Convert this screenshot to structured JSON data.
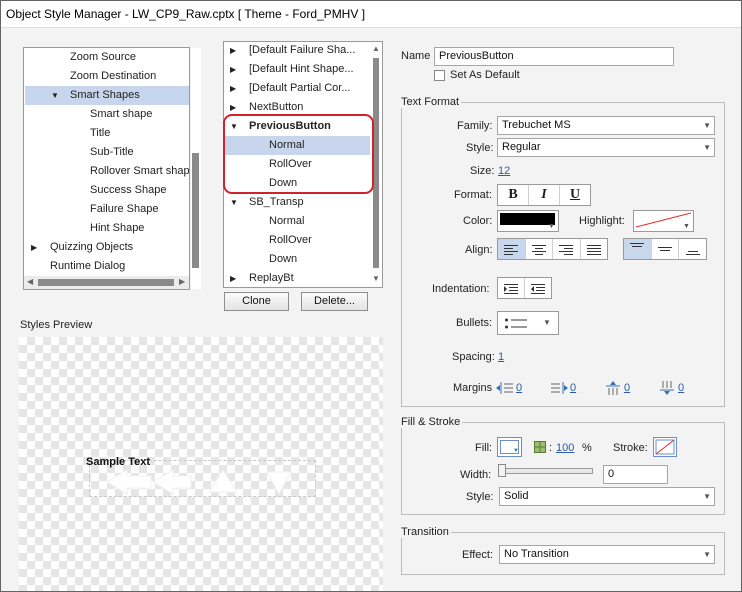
{
  "window": {
    "title": "Object Style Manager - LW_CP9_Raw.cptx [ Theme - Ford_PMHV ]"
  },
  "left_tree": {
    "items": [
      {
        "label": "Zoom Source",
        "level": 1,
        "selected": false
      },
      {
        "label": "Zoom Destination",
        "level": 1,
        "selected": false
      },
      {
        "label": "Smart Shapes",
        "level": 1,
        "expanded": true,
        "selected": true
      },
      {
        "label": "Smart shape",
        "level": 2,
        "selected": false
      },
      {
        "label": "Title",
        "level": 2,
        "selected": false
      },
      {
        "label": "Sub-Title",
        "level": 2,
        "selected": false
      },
      {
        "label": "Rollover Smart shap",
        "level": 2,
        "selected": false
      },
      {
        "label": "Success Shape",
        "level": 2,
        "selected": false
      },
      {
        "label": "Failure Shape",
        "level": 2,
        "selected": false
      },
      {
        "label": "Hint Shape",
        "level": 2,
        "selected": false
      },
      {
        "label": "Quizzing Objects",
        "level": 0,
        "collapsed": true,
        "selected": false
      },
      {
        "label": "Runtime Dialog",
        "level": 0,
        "selected": false
      }
    ]
  },
  "mid_tree": {
    "items": [
      {
        "label": "[Default Failure Sha...",
        "collapsed": true
      },
      {
        "label": "[Default Hint Shape...",
        "collapsed": true
      },
      {
        "label": "[Default Partial Cor...",
        "collapsed": true
      },
      {
        "label": "NextButton",
        "collapsed": true
      },
      {
        "label": "PreviousButton",
        "expanded": true,
        "bold": true
      },
      {
        "label": "Normal",
        "child": true,
        "selected": true
      },
      {
        "label": "RollOver",
        "child": true
      },
      {
        "label": "Down",
        "child": true
      },
      {
        "label": "SB_Transp",
        "expanded": true
      },
      {
        "label": "Normal",
        "child": true
      },
      {
        "label": "RollOver",
        "child": true
      },
      {
        "label": "Down",
        "child": true
      },
      {
        "label": "ReplayBt",
        "collapsed": true
      }
    ]
  },
  "buttons": {
    "clone": "Clone",
    "delete": "Delete..."
  },
  "preview": {
    "heading": "Styles Preview",
    "sample_text": "Sample Text"
  },
  "name_section": {
    "label": "Name",
    "value": "PreviousButton",
    "default_label": "Set As Default",
    "default_checked": false
  },
  "text_format": {
    "heading": "Text Format",
    "family_label": "Family:",
    "family_value": "Trebuchet MS",
    "style_label": "Style:",
    "style_value": "Regular",
    "size_label": "Size:",
    "size_value": "12",
    "format_label": "Format:",
    "format_buttons": [
      "B",
      "I",
      "U"
    ],
    "color_label": "Color:",
    "color_value": "#000000",
    "highlight_label": "Highlight:",
    "align_label": "Align:",
    "indent_label": "Indentation:",
    "bullets_label": "Bullets:",
    "spacing_label": "Spacing:",
    "spacing_value": "1",
    "margins_label": "Margins",
    "margin_values": [
      "0",
      "0",
      "0",
      "0"
    ]
  },
  "fill_stroke": {
    "heading": "Fill & Stroke",
    "fill_label": "Fill:",
    "opacity_value": "100",
    "opacity_unit": "%",
    "stroke_label": "Stroke:",
    "width_label": "Width:",
    "width_value": "0",
    "style_label": "Style:",
    "style_value": "Solid"
  },
  "transition": {
    "heading": "Transition",
    "effect_label": "Effect:",
    "effect_value": "No Transition"
  },
  "colors": {
    "selection": "#c7d6ec",
    "highlight_box": "#d0222a",
    "link": "#2a5aa8"
  }
}
